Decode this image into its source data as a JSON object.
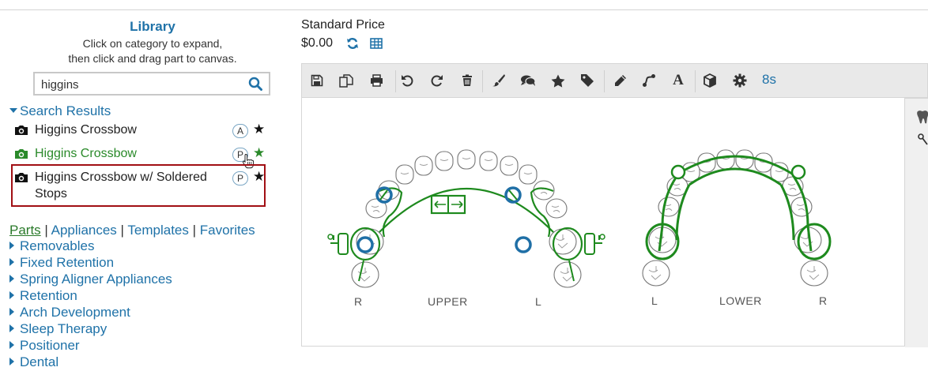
{
  "library": {
    "title": "Library",
    "help_line1": "Click on category to expand,",
    "help_line2": "then click and drag part to canvas.",
    "search_value": "higgins",
    "search_results_label": "Search Results",
    "results": [
      {
        "label": "Higgins Crossbow",
        "badge": "A",
        "color": "#222222"
      },
      {
        "label": "Higgins Crossbow",
        "badge": "P",
        "color": "#2a8a2a"
      },
      {
        "label_line1": "Higgins Crossbow w/ Soldered",
        "label_line2": "Stops",
        "badge": "P",
        "color": "#222222"
      }
    ],
    "tabs": [
      "Parts",
      "Appliances",
      "Templates",
      "Favorites"
    ],
    "tab_separator": "|",
    "categories": [
      "Removables",
      "Fixed Retention",
      "Spring Aligner Appliances",
      "Retention",
      "Arch Development",
      "Sleep Therapy",
      "Positioner",
      "Dental"
    ]
  },
  "price": {
    "label": "Standard Price",
    "value": "$0.00"
  },
  "toolbar": {
    "icons": [
      "save-icon",
      "copy-icon",
      "print-icon",
      "undo-icon",
      "redo-icon",
      "trash-icon",
      "brush-icon",
      "comment-icon",
      "star-icon",
      "tag-icon",
      "pencil-icon",
      "connector-icon",
      "text-icon",
      "cube-icon",
      "gear-icon"
    ],
    "text_glyph": "A",
    "timer": "8s"
  },
  "canvas": {
    "upper": {
      "label": "UPPER",
      "left": "R",
      "right": "L"
    },
    "lower": {
      "label": "LOWER",
      "left": "L",
      "right": "R"
    }
  },
  "colors": {
    "accent": "#1f72a8",
    "appliance": "#1e8a1e",
    "highlight": "#a10f14"
  }
}
